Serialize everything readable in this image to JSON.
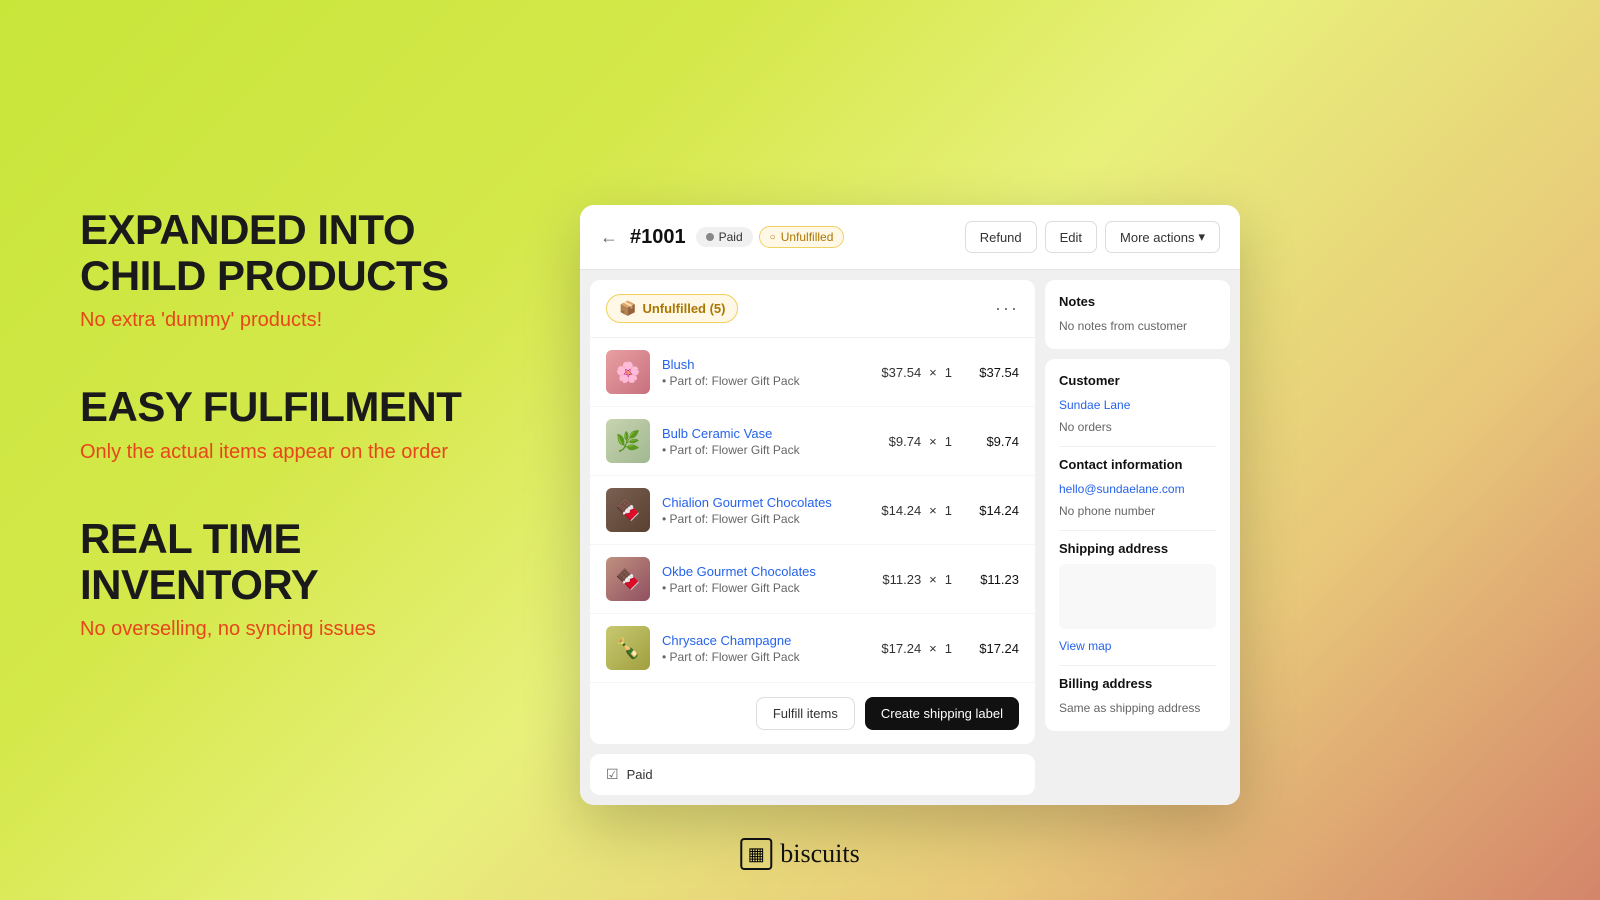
{
  "background": {
    "gradient": "from yellow-green to peach-red"
  },
  "features": [
    {
      "title": "EXPANDED INTO CHILD PRODUCTS",
      "subtitle": "No extra 'dummy' products!"
    },
    {
      "title": "EASY FULFILMENT",
      "subtitle": "Only the actual items appear on the order"
    },
    {
      "title": "REAL TIME INVENTORY",
      "subtitle": "No overselling, no syncing issues"
    }
  ],
  "order": {
    "number": "#1001",
    "status_paid": "Paid",
    "status_fulfillment": "Unfulfilled",
    "section_label": "Unfulfilled (5)",
    "items": [
      {
        "name": "Blush",
        "parent": "Part of: Flower Gift Pack",
        "price": "$37.54",
        "qty": "1",
        "total": "$37.54",
        "emoji": "🌸",
        "color": "blush"
      },
      {
        "name": "Bulb Ceramic Vase",
        "parent": "Part of: Flower Gift Pack",
        "price": "$9.74",
        "qty": "1",
        "total": "$9.74",
        "emoji": "🌿",
        "color": "vase"
      },
      {
        "name": "Chialion Gourmet Chocolates",
        "parent": "Part of: Flower Gift Pack",
        "price": "$14.24",
        "qty": "1",
        "total": "$14.24",
        "emoji": "🍫",
        "color": "choc"
      },
      {
        "name": "Okbe Gourmet Chocolates",
        "parent": "Part of: Flower Gift Pack",
        "price": "$11.23",
        "qty": "1",
        "total": "$11.23",
        "emoji": "🍫",
        "color": "okbe"
      },
      {
        "name": "Chrysace Champagne",
        "parent": "Part of: Flower Gift Pack",
        "price": "$17.24",
        "qty": "1",
        "total": "$17.24",
        "emoji": "🍾",
        "color": "champ"
      }
    ],
    "buttons": {
      "fulfill": "Fulfill items",
      "shipping": "Create shipping label"
    },
    "paid_label": "Paid"
  },
  "header_buttons": {
    "refund": "Refund",
    "edit": "Edit",
    "more_actions": "More actions"
  },
  "customer": {
    "notes_title": "Notes",
    "notes_text": "No notes from customer",
    "customer_title": "Customer",
    "customer_name": "Sundae Lane",
    "orders_text": "No orders",
    "contact_title": "Contact information",
    "email": "hello@sundaelane.com",
    "phone": "No phone number",
    "shipping_title": "Shipping address",
    "view_map": "View map",
    "billing_title": "Billing address",
    "billing_text": "Same as shipping address"
  },
  "logo": {
    "text": "biscuits",
    "icon": "▦"
  }
}
